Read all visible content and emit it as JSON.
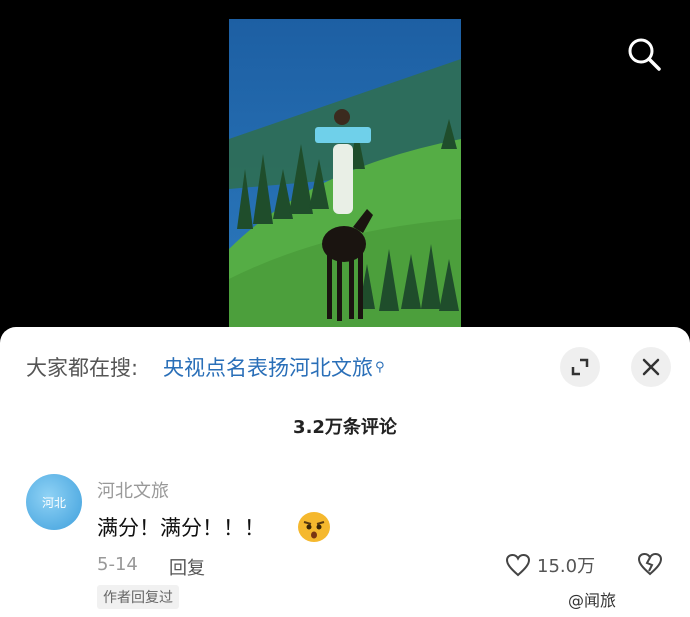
{
  "search": {
    "icon": "search-icon"
  },
  "sheet": {
    "hot_label": "大家都在搜:",
    "hot_query": "央视点名表扬河北文旅",
    "count_title": "3.2万条评论"
  },
  "comment": {
    "author": "河北文旅",
    "avatar_text": "河北",
    "text": "满分！满分！！！",
    "date": "5-14",
    "reply_label": "回复",
    "likes": "15.0万",
    "badge": "作者回复过"
  },
  "watermark": "@闻旅",
  "colors": {
    "accent": "#2a6fb8",
    "background": "#000000",
    "sheet": "#ffffff"
  }
}
